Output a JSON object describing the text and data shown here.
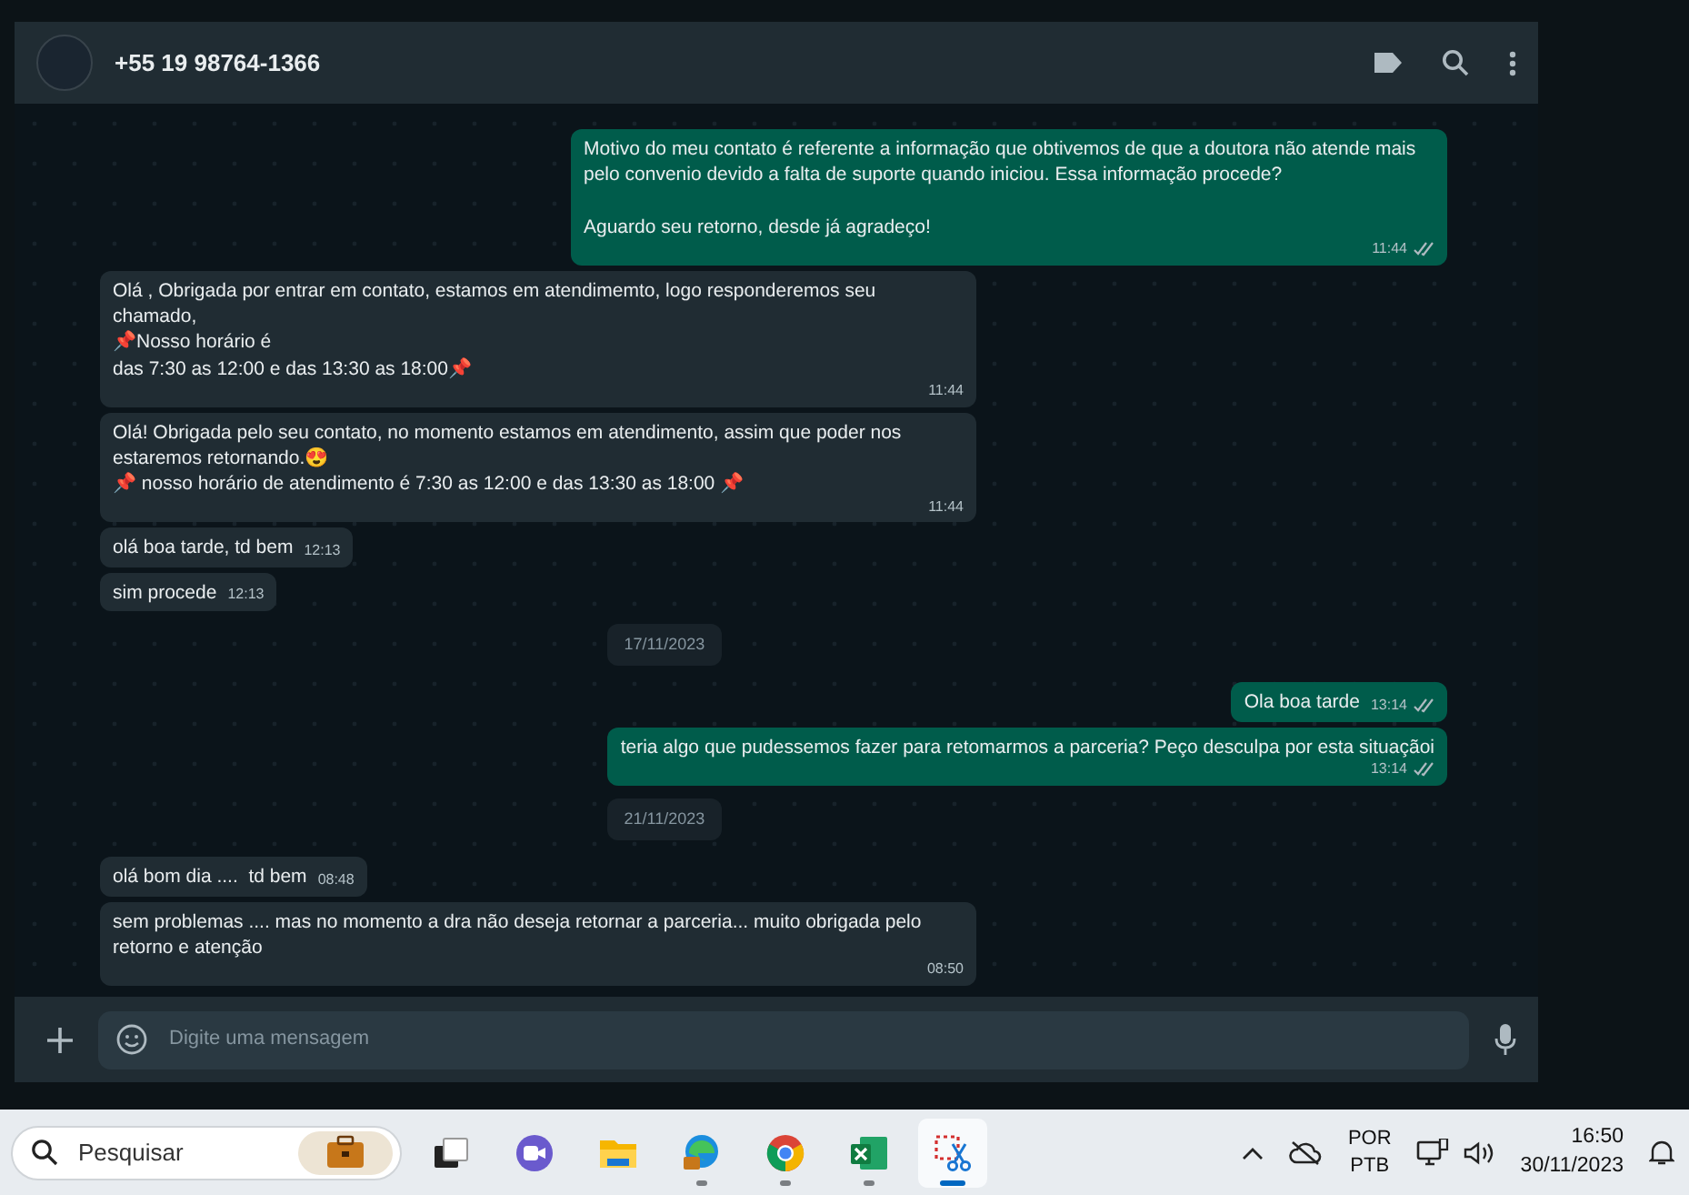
{
  "header": {
    "contact": "+55 19 98764-1366"
  },
  "messages": [
    {
      "kind": "outgoing",
      "text": "Motivo do meu contato é referente a informação que obtivemos de que a doutora não atende mais pelo convenio devido a falta de suporte quando iniciou. Essa informação procede?\n\nAguardo seu retorno, desde já agradeço!",
      "time": "11:44",
      "read": false
    },
    {
      "kind": "incoming",
      "text": "Olá , Obrigada por entrar em contato, estamos em atendimemto, logo responderemos seu chamado,\n📌Nosso horário é\ndas 7:30 as 12:00 e das 13:30 as 18:00📌",
      "time": "11:44"
    },
    {
      "kind": "incoming",
      "text": "Olá! Obrigada pelo seu contato, no momento estamos em atendimento, assim que poder nos estaremos retornando.😍\n📌 nosso horário de atendimento é 7:30 as 12:00 e das 13:30 as 18:00 📌",
      "time": "11:44"
    },
    {
      "kind": "incoming",
      "text": "olá boa tarde, td bem",
      "time": "12:13"
    },
    {
      "kind": "incoming",
      "text": "sim procede",
      "time": "12:13"
    },
    {
      "kind": "date",
      "text": "17/11/2023"
    },
    {
      "kind": "outgoing",
      "text": "Ola boa tarde",
      "time": "13:14",
      "read": false
    },
    {
      "kind": "outgoing",
      "text": "teria algo que pudessemos fazer para retomarmos a parceria? Peço desculpa por esta situaçãoi",
      "time": "13:14",
      "read": false
    },
    {
      "kind": "date",
      "text": "21/11/2023"
    },
    {
      "kind": "incoming",
      "text": "olá bom dia ....  td bem",
      "time": "08:48"
    },
    {
      "kind": "incoming",
      "text": "sem problemas .... mas no momento a dra não deseja retornar a parceria... muito obrigada pelo retorno e atenção",
      "time": "08:50"
    }
  ],
  "composer": {
    "placeholder": "Digite uma mensagem"
  },
  "taskbar": {
    "search_placeholder": "Pesquisar",
    "apps": [
      {
        "kind": "taskview",
        "running": false,
        "selected": false
      },
      {
        "kind": "meet",
        "running": false,
        "selected": false
      },
      {
        "kind": "folder",
        "running": false,
        "selected": false
      },
      {
        "kind": "edge",
        "running": true,
        "selected": false
      },
      {
        "kind": "chrome",
        "running": true,
        "selected": false
      },
      {
        "kind": "excel",
        "running": true,
        "selected": false
      },
      {
        "kind": "snip",
        "running": true,
        "selected": true
      }
    ],
    "language": [
      "POR",
      "PTB"
    ],
    "time": "16:50",
    "date": "30/11/2023"
  }
}
